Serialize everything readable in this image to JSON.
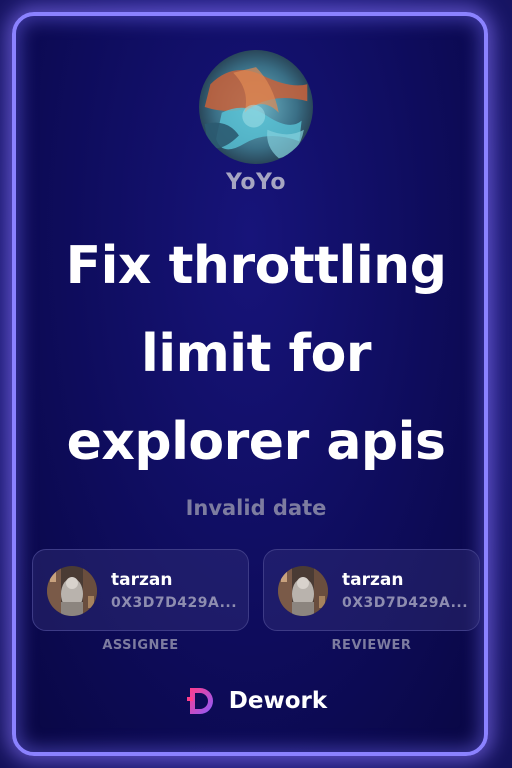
{
  "card": {
    "author": "YoYo",
    "title": "Fix throttling limit for explorer apis",
    "date": "Invalid date"
  },
  "assignee": {
    "name": "tarzan",
    "address": "0X3D7D429A...",
    "role_label": "ASSIGNEE"
  },
  "reviewer": {
    "name": "tarzan",
    "address": "0X3D7D429A...",
    "role_label": "REVIEWER"
  },
  "brand": {
    "name": "Dework",
    "logo_icon": "dework-logo-icon"
  },
  "colors": {
    "frame_border": "#8b82ff",
    "card_background": "#0e0c5c",
    "text_primary": "#ffffff",
    "text_muted": "#7d7ca0",
    "logo_gradient_start": "#ff3d8b",
    "logo_gradient_end": "#8a5cff"
  }
}
